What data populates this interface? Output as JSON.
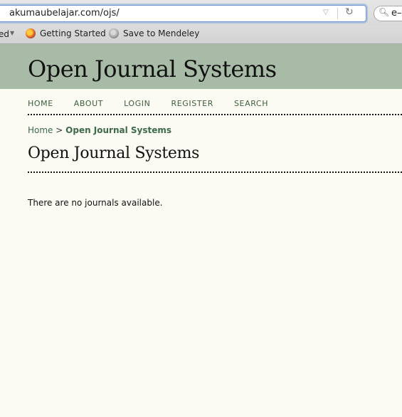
{
  "browser": {
    "url": "akumaubelajar.com/ojs/",
    "search_value": "e–f",
    "bookmarks": {
      "truncated_label": "ed",
      "items": [
        {
          "label": "Getting Started",
          "icon": "firefox-icon"
        },
        {
          "label": "Save to Mendeley",
          "icon": "globe-icon"
        }
      ]
    }
  },
  "header": {
    "site_title": "Open Journal Systems",
    "background": "#a7bba6"
  },
  "nav": {
    "items": [
      "HOME",
      "ABOUT",
      "LOGIN",
      "REGISTER",
      "SEARCH"
    ]
  },
  "breadcrumb": {
    "home": "Home",
    "separator": ">",
    "current": "Open Journal Systems"
  },
  "main": {
    "title": "Open Journal Systems",
    "message": "There are no journals available."
  },
  "colors": {
    "page_bg": "#fbfaf3",
    "link": "#3c6a4a"
  }
}
